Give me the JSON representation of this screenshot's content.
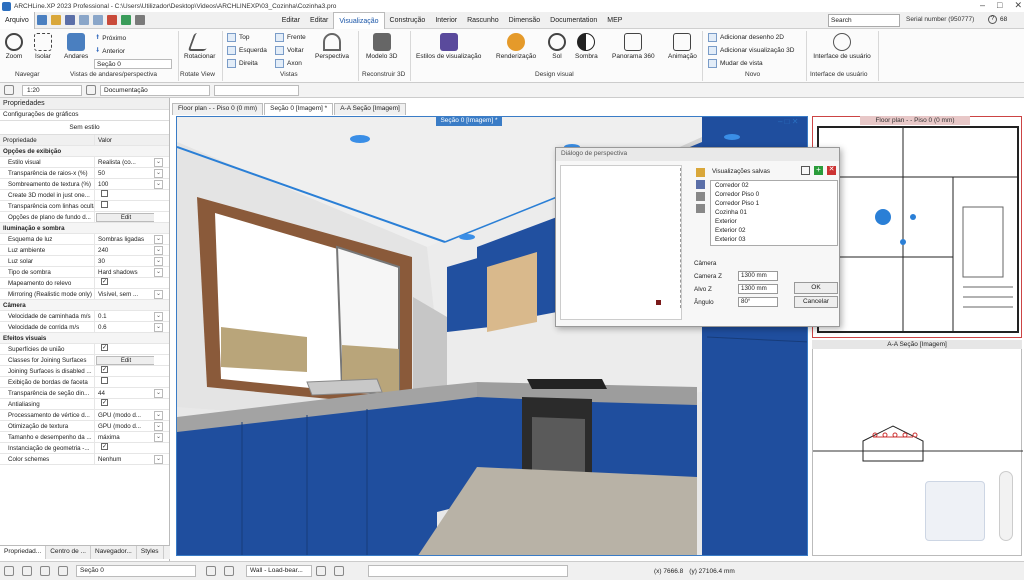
{
  "window": {
    "title": "ARCHLine.XP 2023 Professional - C:\\Users\\Utilizador\\Desktop\\Videos\\ARCHLINEXP\\03_Cozinha\\Cozinha3.pro"
  },
  "menu": {
    "file": "Arquivo",
    "items": [
      "Editar",
      "Editar",
      "Visualização",
      "Construção",
      "Interior",
      "Rascunho",
      "Dimensão",
      "Documentation",
      "MEP"
    ],
    "active": 2
  },
  "search": {
    "placeholder": "Search"
  },
  "serial": "Serial number (950777)",
  "badge": "68",
  "ribbon": {
    "zoom": "Zoom",
    "isolar": "Isolar",
    "andares": "Andares",
    "proximo": "Próximo",
    "anterior": "Anterior",
    "secao_select": "Seção 0",
    "rotacionar": "Rotacionar",
    "top": "Top",
    "esquerda": "Esquerda",
    "direita": "Direita",
    "frente": "Frente",
    "voltar": "Voltar",
    "axon": "Axon",
    "perspectiva": "Perspectiva",
    "modelo3d": "Modelo 3D",
    "estilos": "Estilos de visualização",
    "renderizacao": "Renderização",
    "sol": "Sol",
    "sombra": "Sombra",
    "panorama": "Panorama 360",
    "animacao": "Animação",
    "add_desenho": "Adicionar desenho 2D",
    "add_vis3d": "Adicionar visualização 3D",
    "mudar_vista": "Mudar de vista",
    "interface1": "Interface de usuário",
    "interface2": "Interface de usuário",
    "groups": [
      "Navegar",
      "Vistas de andares/perspectiva",
      "Rotate View",
      "Vistas",
      "Reconstruir 3D",
      "Design visual",
      "Novo",
      "Interface de usuário"
    ]
  },
  "toolbar2": {
    "scale": "1:20",
    "doc": "Documentação"
  },
  "panel": {
    "title": "Propriedades",
    "category": "Configurações de gráficos",
    "style": "Sem estilo",
    "col_prop": "Propriedade",
    "col_val": "Valor",
    "rows": [
      {
        "type": "sec",
        "name": "Opções de exibição"
      },
      {
        "name": "Estilo visual",
        "value": "Realista (co...",
        "dd": true
      },
      {
        "name": "Transparência de raios-x (%)",
        "value": "50",
        "dd": true
      },
      {
        "name": "Sombreamento de textura (%)",
        "value": "100",
        "dd": true
      },
      {
        "name": "Create 3D model in just one...",
        "check": false
      },
      {
        "name": "Transparência com linhas ocultas",
        "check": false
      },
      {
        "name": "Opções de plano de fundo d...",
        "edit": "Edit"
      },
      {
        "type": "sec",
        "name": "Iluminação e sombra"
      },
      {
        "name": "Esquema de luz",
        "value": "Sombras ligadas",
        "dd": true
      },
      {
        "name": "Luz ambiente",
        "value": "240",
        "dd": true
      },
      {
        "name": "Luz solar",
        "value": "30",
        "dd": true
      },
      {
        "name": "Tipo de sombra",
        "value": "Hard shadows",
        "dd": true
      },
      {
        "name": "Mapeamento do relevo",
        "check": true
      },
      {
        "name": "Mirroring (Realistic mode only)",
        "value": "Visível, sem ...",
        "dd": true
      },
      {
        "type": "sec",
        "name": "Câmera"
      },
      {
        "name": "Velocidade de caminhada m/s",
        "value": "0.1",
        "dd": true
      },
      {
        "name": "Velocidade de corrida m/s",
        "value": "0.6",
        "dd": true
      },
      {
        "type": "sec",
        "name": "Efeitos visuais"
      },
      {
        "name": "Superfícies de união",
        "check": true
      },
      {
        "name": "Classes for Joining Surfaces",
        "edit": "Edit"
      },
      {
        "name": "Joining Surfaces is disabled ...",
        "check": true
      },
      {
        "name": "Exibição de bordas de faceta",
        "check": false
      },
      {
        "name": "Transparência de seção din...",
        "value": "44",
        "dd": true
      },
      {
        "name": "Antialiasing",
        "check": true
      },
      {
        "name": "Processamento de vértice d...",
        "value": "GPU (modo d...",
        "dd": true
      },
      {
        "name": "Otimização de textura",
        "value": "GPU (modo d...",
        "dd": true
      },
      {
        "name": "Tamanho e desempenho da ...",
        "value": "máxima",
        "dd": true
      },
      {
        "name": "Instanciação de geometria -...",
        "check": true
      },
      {
        "name": "Color schemes",
        "value": "Nenhum",
        "dd": true
      }
    ],
    "tabs": [
      "Propriedad...",
      "Centro de ...",
      "Navegador...",
      "Styles"
    ]
  },
  "doctabs": [
    "Floor plan - - Piso 0 (0 mm)",
    "Seção 0 [Imagem] *",
    "A-A Seção [Imagem]"
  ],
  "viewport_title": "Seção 0 [Imagem] *",
  "floorplan_title": "Floor plan - - Piso 0 (0 mm)",
  "section_title": "A-A Seção [Imagem]",
  "dialog": {
    "title": "Diálogo de perspectiva",
    "saved_label": "Visualizações salvas",
    "saved": [
      "Corredor 02",
      "Corredor Piso 0",
      "Corredor Piso 1",
      "Cozinha 01",
      "Exterior",
      "Exterior 02",
      "Exterior 03"
    ],
    "camera": "Câmera",
    "camera_z_label": "Camera Z",
    "camera_z": "1300 mm",
    "alvo_z_label": "Alvo Z",
    "alvo_z": "1300 mm",
    "angulo_label": "Ângulo",
    "angulo": "80°",
    "ok": "OK",
    "cancel": "Cancelar"
  },
  "status": {
    "section": "Seção 0",
    "wall": "Wall - Load-bear...",
    "x": "(x) 7666.8",
    "y": "(y) 27106.4 mm"
  },
  "colors": {
    "cabinet": "#1e4e9c",
    "accent": "#3a7cc6",
    "counter": "#9b9b9b"
  }
}
